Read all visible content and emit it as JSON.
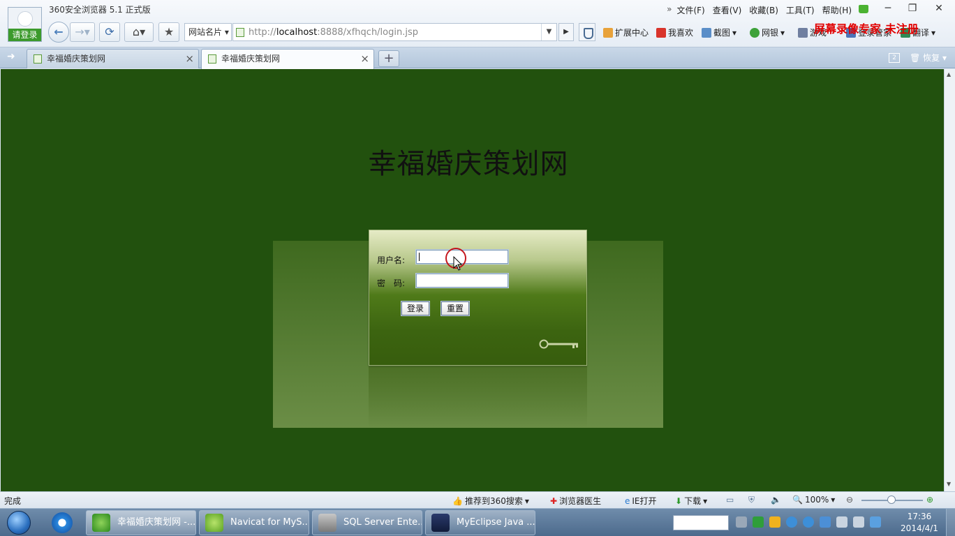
{
  "browser": {
    "title": "360安全浏览器 5.1 正式版",
    "login_badge": "请登录",
    "menu": [
      "文件(F)",
      "查看(V)",
      "收藏(B)",
      "工具(T)",
      "帮助(H)"
    ],
    "site_card": "网站名片",
    "url_prefix": "http://",
    "url_host": "localhost",
    "url_rest": ":8888/xfhqch/login.jsp",
    "toolbar": {
      "extensions": "扩展中心",
      "favorites": "我喜欢",
      "screenshot": "截图",
      "bank": "网银",
      "games": "游戏",
      "butler": "登录管家",
      "translate": "翻译"
    },
    "watermark": "屏幕录像专家 未注册",
    "restore_label": "恢复",
    "tab_count": "2"
  },
  "tabs": [
    {
      "label": "幸福婚庆策划网",
      "active": false
    },
    {
      "label": "幸福婚庆策划网",
      "active": true
    }
  ],
  "page": {
    "title": "幸福婚庆策划网",
    "username_label": "用户名:",
    "password_label": "密　码:",
    "username_value": "",
    "password_value": "",
    "login_button": "登录",
    "reset_button": "重置"
  },
  "statusbar": {
    "status": "完成",
    "recommend": "推荐到360搜索",
    "doctor": "浏览器医生",
    "ie_open": "IE打开",
    "download": "下载",
    "zoom": "100%"
  },
  "taskbar": {
    "items": [
      {
        "label": "幸福婚庆策划网 -...",
        "active": true
      },
      {
        "label": "Navicat for MyS...",
        "active": false
      },
      {
        "label": "SQL Server Ente...",
        "active": false
      },
      {
        "label": "MyEclipse Java ...",
        "active": false
      }
    ],
    "time": "17:36",
    "date": "2014/4/1"
  },
  "colors": {
    "page_bg": "#22510e",
    "watermark": "#e10000",
    "login_badge": "#3c9a2c"
  }
}
